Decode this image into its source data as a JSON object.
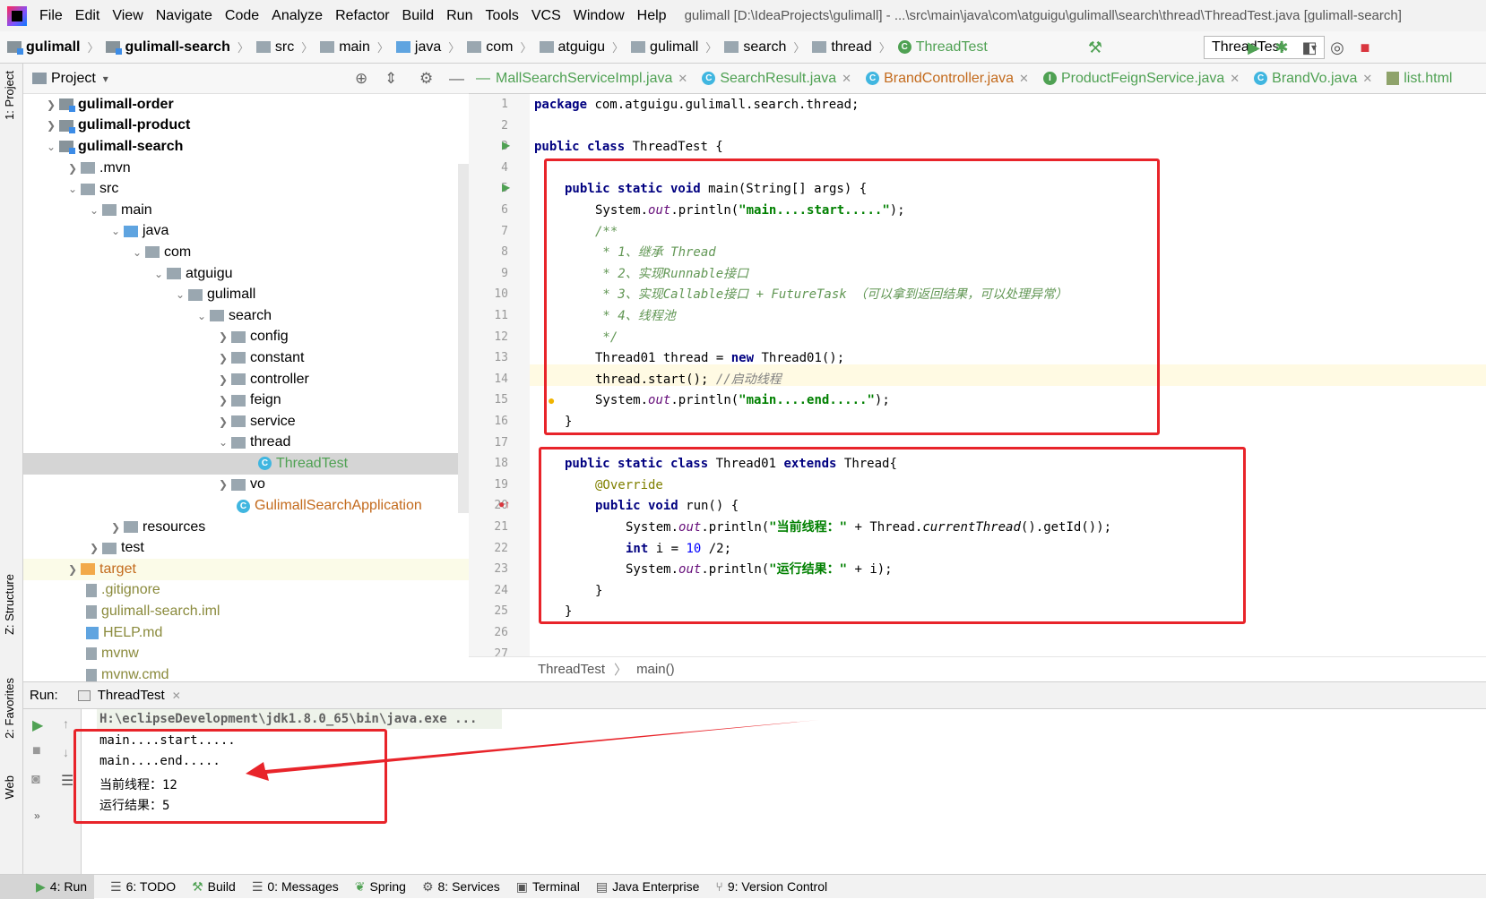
{
  "menu": [
    "File",
    "Edit",
    "View",
    "Navigate",
    "Code",
    "Analyze",
    "Refactor",
    "Build",
    "Run",
    "Tools",
    "VCS",
    "Window",
    "Help"
  ],
  "window_title": "gulimall [D:\\IdeaProjects\\gulimall] - ...\\src\\main\\java\\com\\atguigu\\gulimall\\search\\thread\\ThreadTest.java [gulimall-search]",
  "breadcrumbs": [
    "gulimall",
    "gulimall-search",
    "src",
    "main",
    "java",
    "com",
    "atguigu",
    "gulimall",
    "search",
    "thread",
    "ThreadTest"
  ],
  "run_config": "ThreadTest",
  "project_panel": {
    "title": "Project"
  },
  "tree": [
    {
      "label": "gulimall-order",
      "bold": true
    },
    {
      "label": "gulimall-product",
      "bold": true
    },
    {
      "label": "gulimall-search",
      "bold": true
    },
    {
      "label": ".mvn"
    },
    {
      "label": "src"
    },
    {
      "label": "main"
    },
    {
      "label": "java"
    },
    {
      "label": "com"
    },
    {
      "label": "atguigu"
    },
    {
      "label": "gulimall"
    },
    {
      "label": "search"
    },
    {
      "label": "config"
    },
    {
      "label": "constant"
    },
    {
      "label": "controller"
    },
    {
      "label": "feign"
    },
    {
      "label": "service"
    },
    {
      "label": "thread"
    },
    {
      "label": "ThreadTest"
    },
    {
      "label": "vo"
    },
    {
      "label": "GulimallSearchApplication"
    },
    {
      "label": "resources"
    },
    {
      "label": "test"
    },
    {
      "label": "target"
    },
    {
      "label": ".gitignore"
    },
    {
      "label": "gulimall-search.iml"
    },
    {
      "label": "HELP.md"
    },
    {
      "label": "mvnw"
    },
    {
      "label": "mvnw.cmd"
    }
  ],
  "editor_tabs": [
    "MallSearchServiceImpl.java",
    "SearchResult.java",
    "BrandController.java",
    "ProductFeignService.java",
    "BrandVo.java",
    "list.html"
  ],
  "line_numbers": [
    "1",
    "2",
    "3",
    "4",
    "5",
    "6",
    "7",
    "8",
    "9",
    "10",
    "11",
    "12",
    "13",
    "14",
    "15",
    "16",
    "17",
    "18",
    "19",
    "20",
    "21",
    "22",
    "23",
    "24",
    "25",
    "26",
    "27"
  ],
  "code": {
    "l1_kw": "package",
    "l1": " com.atguigu.gulimall.search.thread;",
    "l3_kw": "public class",
    "l3": " ThreadTest {",
    "l5_kw": "public static void",
    "l5": " main(String[] args) {",
    "l6_a": "System.",
    "l6_b": "out",
    "l6_c": ".println(",
    "l6_s": "\"main....start.....\"",
    "l6_d": ");",
    "l7": "/**",
    "l8": " * 1、继承 Thread",
    "l9": " * 2、实现Runnable接口",
    "l10": " * 3、实现Callable接口 + FutureTask （可以拿到返回结果，可以处理异常）",
    "l11": " * 4、线程池",
    "l12": " */",
    "l13_a": "Thread01 thread = ",
    "l13_kw": "new",
    "l13_b": " Thread01();",
    "l14_a": "thread.start(); ",
    "l14_c": "//启动线程",
    "l15_a": "System.",
    "l15_b": "out",
    "l15_c": ".println(",
    "l15_s": "\"main....end.....\"",
    "l15_d": ");",
    "l16": "}",
    "l18_kw": "public static class",
    "l18_a": " Thread01 ",
    "l18_kw2": "extends",
    "l18_b": " Thread{",
    "l19": "@Override",
    "l20_kw": "public void",
    "l20": " run() {",
    "l21_a": "System.",
    "l21_b": "out",
    "l21_c": ".println(",
    "l21_s": "\"当前线程：\"",
    "l21_d": " + Thread.",
    "l21_e": "currentThread",
    "l21_f": "().getId());",
    "l22_kw": "int",
    "l22_a": " i = ",
    "l22_n": "10",
    "l22_b": " /2;",
    "l23_a": "System.",
    "l23_b": "out",
    "l23_c": ".println(",
    "l23_s": "\"运行结果：\"",
    "l23_d": " + i);",
    "l24": "}",
    "l25": "}"
  },
  "editor_breadcrumb": [
    "ThreadTest",
    "main()"
  ],
  "run_panel": {
    "label": "Run:",
    "tab": "ThreadTest"
  },
  "console": {
    "cmd": "H:\\eclipseDevelopment\\jdk1.8.0_65\\bin\\java.exe ...",
    "lines": [
      "main....start.....",
      "main....end.....",
      "当前线程：12",
      "运行结果：5"
    ]
  },
  "side_tabs": {
    "project": "1: Project",
    "structure": "Z: Structure",
    "favorites": "2: Favorites",
    "web": "Web"
  },
  "bottom_tools": [
    "4: Run",
    "6: TODO",
    "Build",
    "0: Messages",
    "Spring",
    "8: Services",
    "Terminal",
    "Java Enterprise",
    "9: Version Control"
  ],
  "colors": {
    "annotation_red": "#e8242a",
    "keyword": "#000080",
    "string": "#008000",
    "comment": "#629755"
  }
}
